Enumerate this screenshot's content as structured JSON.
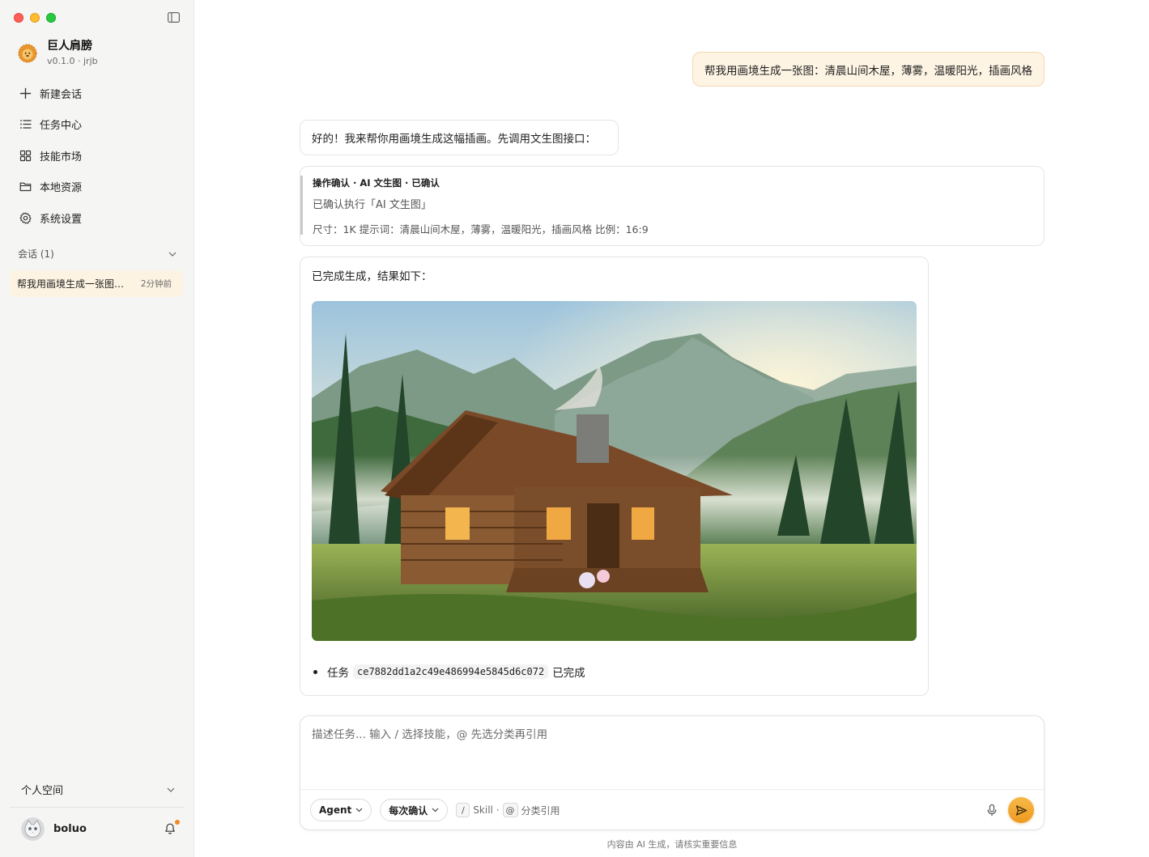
{
  "app": {
    "name": "巨人肩膀",
    "version_line": "v0.1.0 · jrjb"
  },
  "sidebar": {
    "nav": [
      {
        "label": "新建会话",
        "icon": "plus-icon"
      },
      {
        "label": "任务中心",
        "icon": "list-icon"
      },
      {
        "label": "技能市场",
        "icon": "grid-icon"
      },
      {
        "label": "本地资源",
        "icon": "folder-icon"
      },
      {
        "label": "系统设置",
        "icon": "gear-icon"
      }
    ],
    "conversations_header": "会话 (1)",
    "conversations": [
      {
        "title": "帮我用画境生成一张图…",
        "time": "2分钟前"
      }
    ],
    "workspace": "个人空间",
    "user": {
      "name": "boluo",
      "has_notification": true
    }
  },
  "chat": {
    "user_message": "帮我用画境生成一张图：清晨山间木屋，薄雾，温暖阳光，插画风格",
    "ai_message": "好的！我来帮你用画境生成这幅插画。先调用文生图接口：",
    "confirm": {
      "title": "操作确认 · AI 文生图 · 已确认",
      "line1": "已确认执行「AI 文生图」",
      "line2": "尺寸：1K 提示词：清晨山间木屋，薄雾，温暖阳光，插画风格 比例：16:9"
    },
    "result": {
      "text": "已完成生成，结果如下：",
      "task_prefix": "任务",
      "task_id": "ce7882dd1a2c49e486994e5845d6c072",
      "task_suffix": "已完成"
    }
  },
  "composer": {
    "placeholder": "描述任务... 输入 / 选择技能，@ 先选分类再引用",
    "mode_label": "Agent",
    "confirm_label": "每次确认",
    "hint_slash": "/",
    "hint_skill": "Skill ·",
    "hint_at": "@",
    "hint_ref": "分类引用"
  },
  "footer_note": "内容由 AI 生成，请核实重要信息",
  "colors": {
    "accent": "#f0a22e",
    "user_bubble_bg": "#fef4e4",
    "active_conversation_bg": "#fdf3e2",
    "sidebar_bg": "#f5f5f4"
  }
}
